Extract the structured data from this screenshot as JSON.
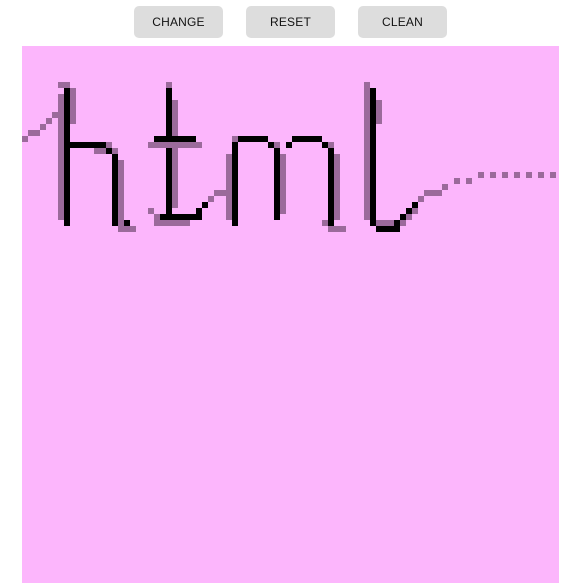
{
  "toolbar": {
    "change_label": "CHANGE",
    "reset_label": "RESET",
    "clean_label": "CLEAN"
  },
  "canvas": {
    "background_color": "#fcb6fc",
    "pixel_colors": {
      "ink": "#000000",
      "mid": "#4b2d4b",
      "light": "#9b6a9b"
    }
  }
}
